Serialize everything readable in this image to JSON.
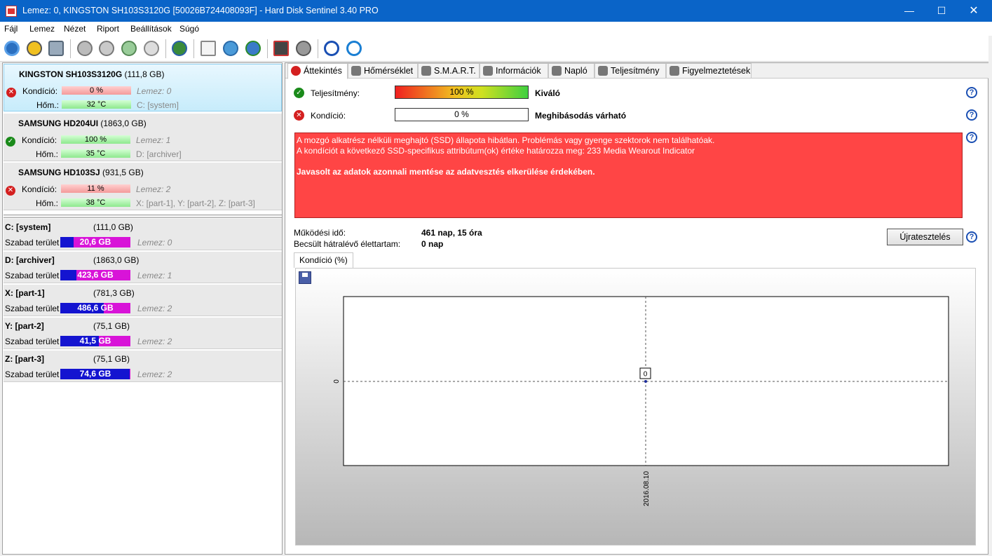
{
  "window": {
    "title": "Lemez: 0, KINGSTON SH103S3120G [50026B724408093F]  -  Hard Disk Sentinel 3.40 PRO",
    "minimize": "—",
    "maximize": "☐",
    "close": "✕"
  },
  "menu": [
    "Fájl",
    "Lemez",
    "Nézet",
    "Riport",
    "Beállítások",
    "Súgó"
  ],
  "toolbar": [
    "refresh-icon",
    "warning-icon",
    "disk-icon",
    "drive-test-icon",
    "drive-test-2-icon",
    "drive-check-icon",
    "drive-tools-icon",
    "globe-icon",
    "report-icon",
    "update-icon",
    "network-icon",
    "monitor-icon",
    "sound-icon",
    "help-icon",
    "info-icon"
  ],
  "disks": [
    {
      "name": "KINGSTON SH103S3120G",
      "size": "(111,8 GB)",
      "status": "bad",
      "condition_label": "Kondíció:",
      "condition": "0 %",
      "condition_bar": "red",
      "temp_label": "Hőm.:",
      "temp": "32 °C",
      "disk_info": "Lemez: 0",
      "partitions_text": "C: [system]"
    },
    {
      "name": "SAMSUNG HD204UI",
      "size": "(1863,0 GB)",
      "status": "good",
      "condition_label": "Kondíció:",
      "condition": "100 %",
      "condition_bar": "green",
      "temp_label": "Hőm.:",
      "temp": "35 °C",
      "disk_info": "Lemez: 1",
      "partitions_text": "D: [archiver]"
    },
    {
      "name": "SAMSUNG HD103SJ",
      "size": "(931,5 GB)",
      "status": "bad",
      "condition_label": "Kondíció:",
      "condition": "11 %",
      "condition_bar": "red",
      "temp_label": "Hőm.:",
      "temp": "38 °C",
      "disk_info": "Lemez: 2",
      "partitions_text": "X: [part-1], Y: [part-2], Z: [part-3]"
    }
  ],
  "volumes": [
    {
      "name": "C: [system]",
      "size": "(111,0 GB)",
      "free_label": "Szabad terület",
      "free": "20,6 GB",
      "disk": "Lemez: 0",
      "free_fraction": 0.81
    },
    {
      "name": "D: [archiver]",
      "size": "(1863,0 GB)",
      "free_label": "Szabad terület",
      "free": "423,6 GB",
      "disk": "Lemez: 1",
      "free_fraction": 0.77
    },
    {
      "name": "X: [part-1]",
      "size": "(781,3 GB)",
      "free_label": "Szabad terület",
      "free": "486,6 GB",
      "disk": "Lemez: 2",
      "free_fraction": 0.38
    },
    {
      "name": "Y: [part-2]",
      "size": "(75,1 GB)",
      "free_label": "Szabad terület",
      "free": "41,5 GB",
      "disk": "Lemez: 2",
      "free_fraction": 0.45
    },
    {
      "name": "Z: [part-3]",
      "size": "(75,1 GB)",
      "free_label": "Szabad terület",
      "free": "74,6 GB",
      "disk": "Lemez: 2",
      "free_fraction": 0.01
    }
  ],
  "tabs": [
    "Áttekintés",
    "Hőmérséklet",
    "S.M.A.R.T.",
    "Információk",
    "Napló",
    "Teljesítmény",
    "Figyelmeztetések"
  ],
  "overview": {
    "performance_label": "Teljesítmény:",
    "performance_value": "100 %",
    "performance_text": "Kiváló",
    "condition_label": "Kondíció:",
    "condition_value": "0 %",
    "condition_text": "Meghibásodás várható",
    "message_line1": "A mozgó alkatrész nélküli meghajtó (SSD) állapota hibátlan. Problémás vagy gyenge szektorok nem találhatóak.",
    "message_line2": "A kondíciót a következő SSD-specifikus attribútum(ok) értéke határozza meg:  233 Media Wearout Indicator",
    "message_line3": "Javasolt az adatok azonnali mentése az adatvesztés elkerülése érdekében.",
    "uptime_label": "Működési idő:",
    "uptime_value": "461 nap, 15 óra",
    "remaining_label": "Becsült hátralévő élettartam:",
    "remaining_value": "0 nap",
    "retest_button": "Újratesztelés",
    "help": "?"
  },
  "chart_tab": "Kondíció  (%)",
  "chart_data": {
    "type": "line",
    "x": [
      "2016.08.10"
    ],
    "series": [
      {
        "values": [
          0
        ]
      }
    ],
    "y_tick": "0",
    "point_label": "0",
    "grid": true
  }
}
